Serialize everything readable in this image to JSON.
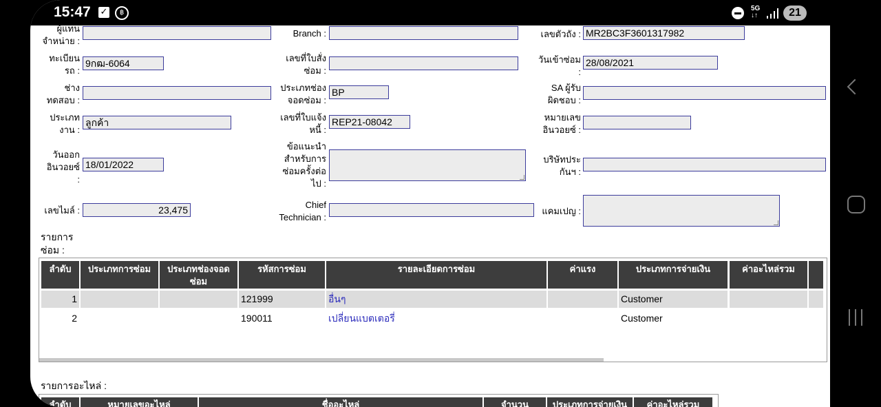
{
  "status_bar": {
    "time": "15:47",
    "battery": "21",
    "network": "5G"
  },
  "form": {
    "dealer_label": "ผู้แทน\nจำหน่าย :",
    "dealer_value": "",
    "branch_label": "Branch :",
    "branch_value": "",
    "chassis_label": "เลขตัวถัง :",
    "chassis_value": "MR2BC3F3601317982",
    "plate_label": "ทะเบียน\nรถ :",
    "plate_value": "9กฒ-6064",
    "repair_order_label": "เลขที่ใบสั่ง\nซ่อม :",
    "repair_order_value": "",
    "service_date_label": "วันเข้าซ่อม\n:",
    "service_date_value": "28/08/2021",
    "test_tech_label": "ช่าง\nทดสอบ :",
    "test_tech_value": "",
    "bay_type_label": "ประเภทช่อง\nจอดซ่อม :",
    "bay_type_value": "BP",
    "sa_label": "SA ผู้รับ\nผิดชอบ :",
    "sa_value": "",
    "job_type_label": "ประเภท\nงาน :",
    "job_type_value": "ลูกค้า",
    "debt_notice_label": "เลขที่ใบแจ้ง\nหนี้ :",
    "debt_notice_value": "REP21-08042",
    "invoice_no_label": "หมายเลข\nอินวอยซ์ :",
    "invoice_no_value": "",
    "invoice_date_label": "วันออก\nอินวอยซ์\n:",
    "invoice_date_value": "18/01/2022",
    "advice_label": "ข้อแนะนำ\nสำหรับการ\nซ่อมครั้งต่อ\nไป :",
    "advice_value": "",
    "insurer_label": "บริษัทประ\nกันฯ :",
    "insurer_value": "",
    "mileage_label": "เลขไมล์ :",
    "mileage_value": "23,475",
    "chief_tech_label": "Chief\nTechnician :",
    "chief_tech_value": "",
    "campaign_label": "แคมเปญ :",
    "campaign_value": ""
  },
  "repair_section": {
    "title": "รายการ\nซ่อม :",
    "columns": [
      "ลำดับ",
      "ประเภทการซ่อม",
      "ประเภทช่องจอด\nซ่อม",
      "รหัสการซ่อม",
      "รายละเอียดการซ่อม",
      "ค่าแรง",
      "ประเภทการจ่ายเงิน",
      "ค่าอะไหล่รวม"
    ],
    "rows": [
      {
        "no": "1",
        "repair_type": "",
        "bay_type": "",
        "code": "121999",
        "detail": "อื่นๆ",
        "labor": "",
        "payment": "Customer",
        "parts_total": ""
      },
      {
        "no": "2",
        "repair_type": "",
        "bay_type": "",
        "code": "190011",
        "detail": "เปลี่ยนแบตเตอรี่",
        "labor": "",
        "payment": "Customer",
        "parts_total": ""
      }
    ]
  },
  "parts_section": {
    "title": "รายการอะไหล่ :",
    "columns": [
      "ลำดับ",
      "หมายเลขอะไหล่",
      "ชื่ออะไหล่",
      "จำนวน",
      "ประเภทการจ่ายเงิน",
      "ค่าอะไหล่รวม"
    ]
  }
}
